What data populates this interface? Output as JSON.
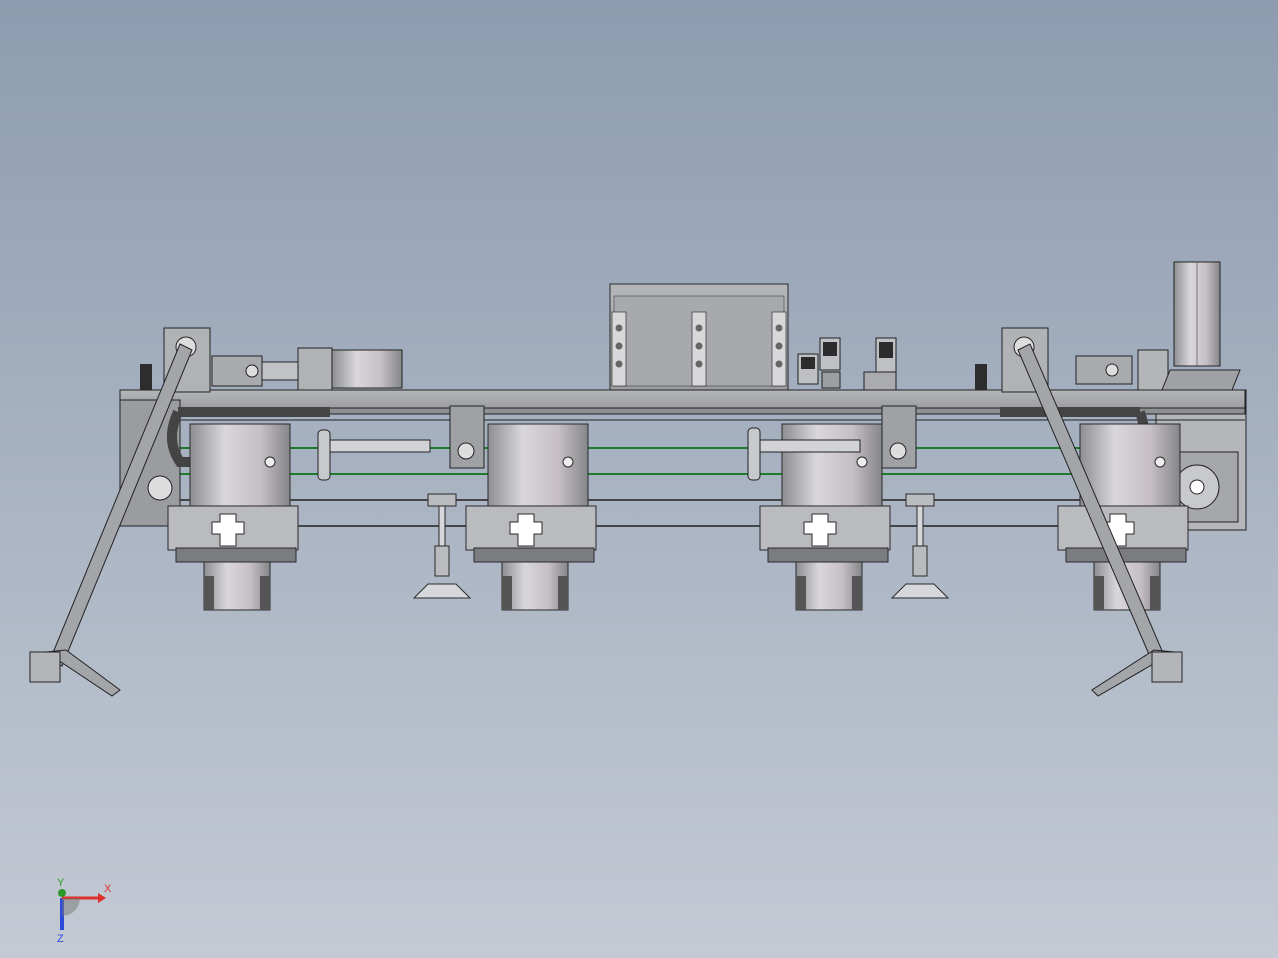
{
  "viewport": {
    "background_top": "#8d9cb0",
    "background_bottom": "#c4cad4"
  },
  "model": {
    "part_fill": "#b9bbbf",
    "part_dark": "#7a7c80",
    "outline": "#2a2a2a",
    "belt_color": "#1f7a2a",
    "motor_count": 4,
    "suction_cup_count": 2
  },
  "triad": {
    "x_label": "X",
    "y_label": "Y",
    "z_label": "Z",
    "x_color": "#e0302a",
    "y_color": "#2a9a2a",
    "z_color": "#2c4bd8"
  }
}
